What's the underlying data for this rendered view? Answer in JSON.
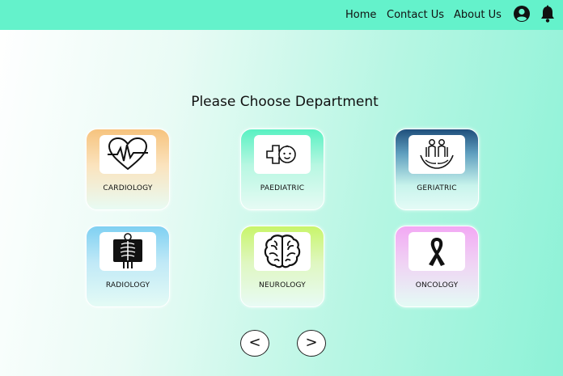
{
  "nav": {
    "home": "Home",
    "contact": "Contact Us",
    "about": "About Us",
    "profile_icon": "user-circle-icon",
    "notification_icon": "bell-icon"
  },
  "heading": "Please Choose Department",
  "departments": [
    {
      "label": "CARDIOLOGY",
      "icon": "heart-pulse-icon"
    },
    {
      "label": "PAEDIATRIC",
      "icon": "baby-cross-icon"
    },
    {
      "label": "GERIATRIC",
      "icon": "elderly-care-icon"
    },
    {
      "label": "RADIOLOGY",
      "icon": "xray-icon"
    },
    {
      "label": "NEUROLOGY",
      "icon": "brain-icon"
    },
    {
      "label": "ONCOLOGY",
      "icon": "ribbon-icon"
    }
  ],
  "pagination": {
    "prev": "<",
    "next": ">"
  },
  "colors": {
    "navbar": "#64f2cb",
    "cardiology_top": "#f6c37e",
    "paediatric_top": "#59f1c2",
    "geriatric_top": "#1f4f7c",
    "radiology_top": "#7fd0f2",
    "neurology_top": "#c8f56a",
    "oncology_top": "#f2a8f4"
  }
}
